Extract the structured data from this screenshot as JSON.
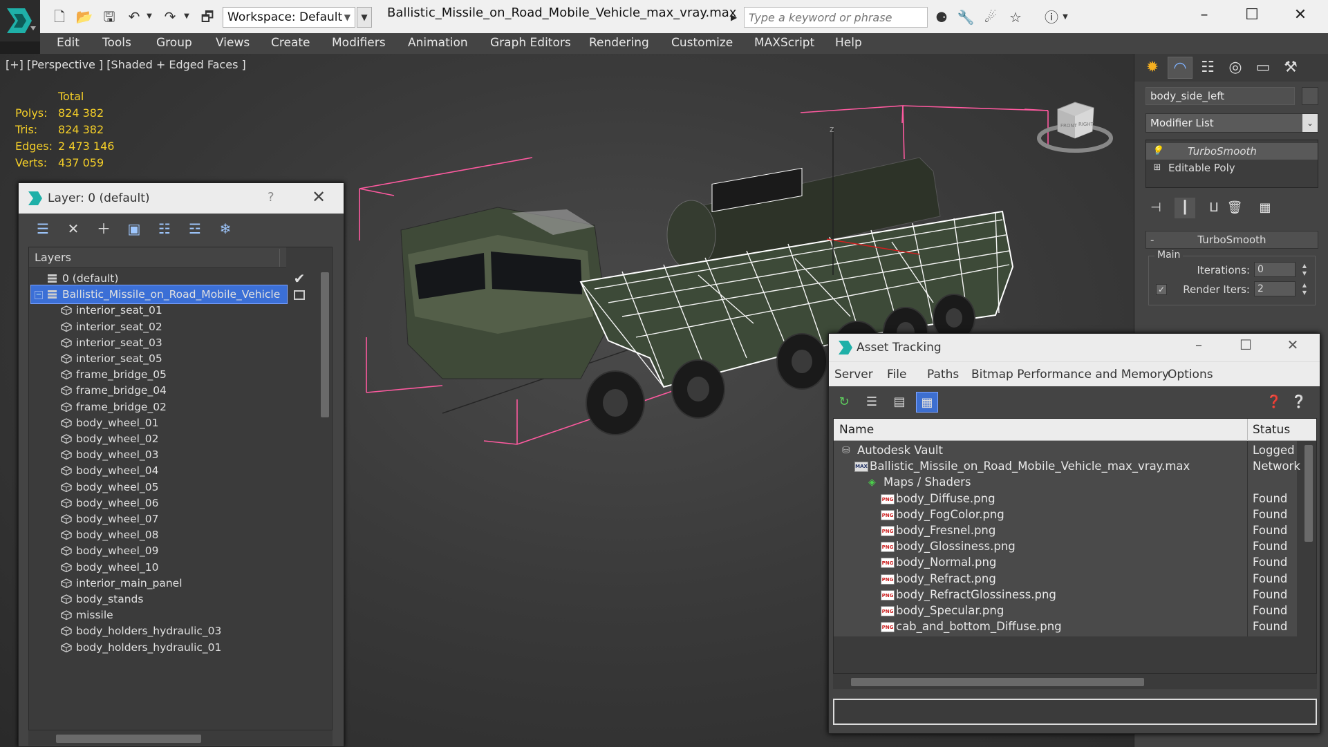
{
  "titlebar": {
    "workspace_label": "Workspace: Default",
    "file_title": "Ballistic_Missile_on_Road_Mobile_Vehicle_max_vray.max",
    "search_placeholder": "Type a keyword or phrase"
  },
  "menu": [
    "Edit",
    "Tools",
    "Group",
    "Views",
    "Create",
    "Modifiers",
    "Animation",
    "Graph Editors",
    "Rendering",
    "Customize",
    "MAXScript",
    "Help"
  ],
  "viewport": {
    "label": "[+] [Perspective ] [Shaded + Edged Faces ]",
    "stats": {
      "total_label": "Total",
      "rows": [
        {
          "label": "Polys:",
          "value": "824 382"
        },
        {
          "label": "Tris:",
          "value": "824 382"
        },
        {
          "label": "Edges:",
          "value": "2 473 146"
        },
        {
          "label": "Verts:",
          "value": "437 059"
        }
      ]
    },
    "axis_label": "z",
    "viewcube_labels": [
      "FRONT",
      "RIGHT"
    ]
  },
  "command_panel": {
    "object_name": "body_side_left",
    "modifier_list_label": "Modifier List",
    "stack": [
      "TurboSmooth",
      "Editable Poly"
    ],
    "rollout_title": "TurboSmooth",
    "group_title": "Main",
    "params": [
      {
        "label": "Iterations:",
        "value": "0"
      },
      {
        "label": "Render Iters:",
        "value": "2"
      }
    ]
  },
  "layer_dialog": {
    "title": "Layer: 0 (default)",
    "help": "?",
    "header": "Layers",
    "rows": [
      {
        "label": "0 (default)",
        "type": "layer",
        "checked": true
      },
      {
        "label": "Ballistic_Missile_on_Road_Mobile_Vehicle",
        "type": "layer",
        "selected": true
      },
      {
        "label": "interior_seat_01",
        "type": "object"
      },
      {
        "label": "interior_seat_02",
        "type": "object"
      },
      {
        "label": "interior_seat_03",
        "type": "object"
      },
      {
        "label": "interior_seat_05",
        "type": "object"
      },
      {
        "label": "frame_bridge_05",
        "type": "object"
      },
      {
        "label": "frame_bridge_04",
        "type": "object"
      },
      {
        "label": "frame_bridge_02",
        "type": "object"
      },
      {
        "label": "body_wheel_01",
        "type": "object"
      },
      {
        "label": "body_wheel_02",
        "type": "object"
      },
      {
        "label": "body_wheel_03",
        "type": "object"
      },
      {
        "label": "body_wheel_04",
        "type": "object"
      },
      {
        "label": "body_wheel_05",
        "type": "object"
      },
      {
        "label": "body_wheel_06",
        "type": "object"
      },
      {
        "label": "body_wheel_07",
        "type": "object"
      },
      {
        "label": "body_wheel_08",
        "type": "object"
      },
      {
        "label": "body_wheel_09",
        "type": "object"
      },
      {
        "label": "body_wheel_10",
        "type": "object"
      },
      {
        "label": "interior_main_panel",
        "type": "object"
      },
      {
        "label": "body_stands",
        "type": "object"
      },
      {
        "label": "missile",
        "type": "object"
      },
      {
        "label": "body_holders_hydraulic_03",
        "type": "object"
      },
      {
        "label": "body_holders_hydraulic_01",
        "type": "object"
      }
    ]
  },
  "asset_dialog": {
    "title": "Asset Tracking",
    "menu": [
      "Server",
      "File",
      "Paths",
      "Bitmap Performance and Memory",
      "Options"
    ],
    "columns": [
      "Name",
      "Status"
    ],
    "rows": [
      {
        "name": "Autodesk Vault",
        "status": "Logged",
        "indent": 0,
        "icon": "vault-icon"
      },
      {
        "name": "Ballistic_Missile_on_Road_Mobile_Vehicle_max_vray.max",
        "status": "Network",
        "indent": 1,
        "icon": "max-file-icon"
      },
      {
        "name": "Maps / Shaders",
        "status": "",
        "indent": 2,
        "icon": "maps-icon"
      },
      {
        "name": "body_Diffuse.png",
        "status": "Found",
        "indent": 3,
        "icon": "png-icon"
      },
      {
        "name": "body_FogColor.png",
        "status": "Found",
        "indent": 3,
        "icon": "png-icon"
      },
      {
        "name": "body_Fresnel.png",
        "status": "Found",
        "indent": 3,
        "icon": "png-icon"
      },
      {
        "name": "body_Glossiness.png",
        "status": "Found",
        "indent": 3,
        "icon": "png-icon"
      },
      {
        "name": "body_Normal.png",
        "status": "Found",
        "indent": 3,
        "icon": "png-icon"
      },
      {
        "name": "body_Refract.png",
        "status": "Found",
        "indent": 3,
        "icon": "png-icon"
      },
      {
        "name": "body_RefractGlossiness.png",
        "status": "Found",
        "indent": 3,
        "icon": "png-icon"
      },
      {
        "name": "body_Specular.png",
        "status": "Found",
        "indent": 3,
        "icon": "png-icon"
      },
      {
        "name": "cab_and_bottom_Diffuse.png",
        "status": "Found",
        "indent": 3,
        "icon": "png-icon"
      }
    ]
  },
  "colors": {
    "stats_text": "#f5cf28",
    "selection": "#3b6fd6",
    "bbox_pink": "#ff5aa0"
  }
}
